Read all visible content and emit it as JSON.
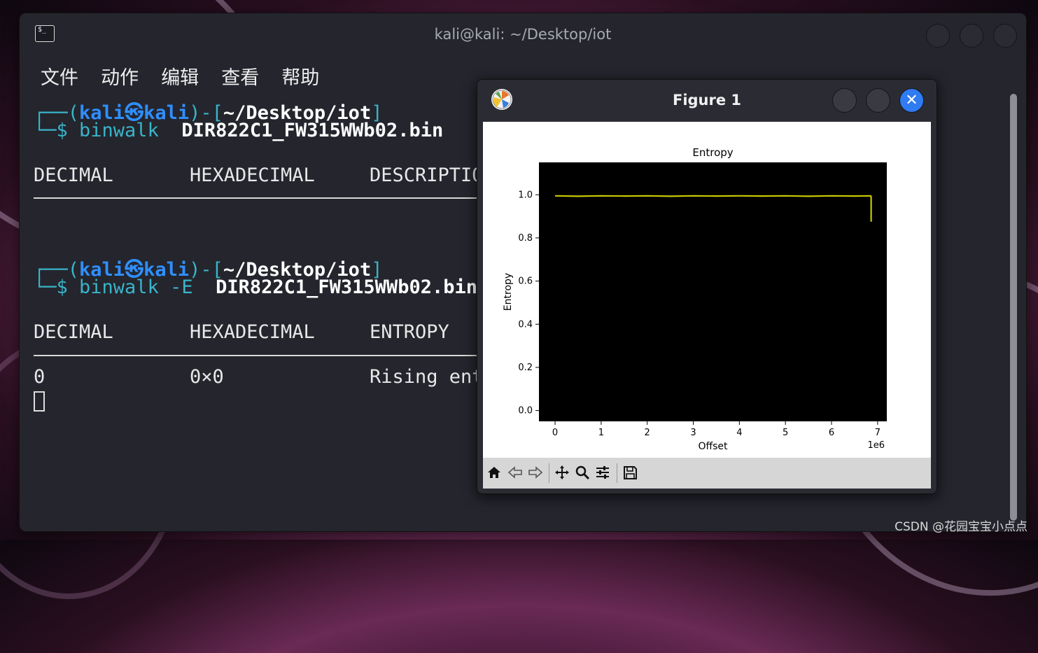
{
  "terminal": {
    "title": "kali@kali: ~/Desktop/iot",
    "menu": [
      "文件",
      "动作",
      "编辑",
      "查看",
      "帮助"
    ],
    "prompt1": {
      "corner": "┌──(",
      "user": "kali",
      "at": "㉿",
      "host": "kali",
      "sep": ")-[",
      "path": "~/Desktop/iot",
      "close": "]"
    },
    "cmd1": {
      "prefix": "└─$ ",
      "command": "binwalk",
      "args": "  DIR822C1_FW315WWb02.bin"
    },
    "headers1": {
      "decimal": "DECIMAL",
      "hex": "HEXADECIMAL",
      "desc": "DESCRIPTIO"
    },
    "prompt2": {
      "corner": "┌──(",
      "user": "kali",
      "at": "㉿",
      "host": "kali",
      "sep": ")-[",
      "path": "~/Desktop/iot",
      "close": "]"
    },
    "cmd2": {
      "prefix": "└─$ ",
      "command": "binwalk -E",
      "args": "  DIR822C1_FW315WWb02.bin"
    },
    "headers2": {
      "decimal": "DECIMAL",
      "hex": "HEXADECIMAL",
      "entropy": "ENTROPY"
    },
    "row": {
      "decimal": "0",
      "hex": "0×0",
      "desc": "Rising ent"
    }
  },
  "figure": {
    "title": "Figure 1",
    "close_glyph": "✕",
    "toolbar": [
      "home-icon",
      "back-icon",
      "forward-icon",
      "pan-icon",
      "zoom-icon",
      "configure-icon",
      "save-icon"
    ]
  },
  "chart_data": {
    "type": "line",
    "title": "Entropy",
    "xlabel": "Offset",
    "ylabel": "Entropy",
    "x_offset_text": "1e6",
    "xlim": [
      -0.35,
      7.2
    ],
    "ylim": [
      -0.05,
      1.15
    ],
    "xticks": [
      0,
      1,
      2,
      3,
      4,
      5,
      6,
      7
    ],
    "yticks": [
      0.0,
      0.2,
      0.4,
      0.6,
      0.8,
      1.0
    ],
    "ytick_labels": [
      "0.0",
      "0.2",
      "0.4",
      "0.6",
      "0.8",
      "1.0"
    ],
    "background": "#000000",
    "series": [
      {
        "color": "#c8c800",
        "x": [
          0,
          0.5,
          1,
          1.5,
          2,
          2.5,
          3,
          3.5,
          4,
          4.5,
          5,
          5.5,
          6,
          6.5,
          6.85,
          6.86,
          6.86
        ],
        "y": [
          0.995,
          0.993,
          0.995,
          0.994,
          0.995,
          0.993,
          0.995,
          0.994,
          0.995,
          0.994,
          0.995,
          0.993,
          0.995,
          0.994,
          0.995,
          0.99,
          0.875
        ]
      }
    ]
  },
  "watermark": "CSDN @花园宝宝小点点"
}
